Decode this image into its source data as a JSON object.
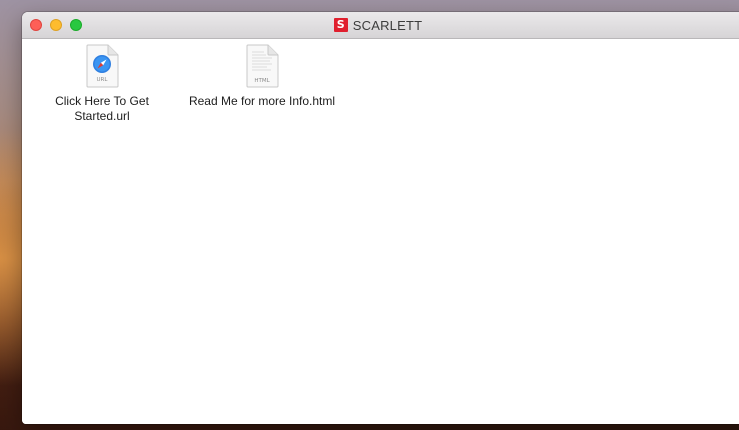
{
  "window": {
    "title": "SCARLETT",
    "logo_letter": "S",
    "logo_color": "#e01f2e"
  },
  "traffic_lights": {
    "close_color": "#fe5f57",
    "minimize_color": "#febc2e",
    "maximize_color": "#28c840"
  },
  "files": [
    {
      "name": "Click Here To Get Started.url",
      "label_line1": "Click Here To Get",
      "label_line2": "Started.url",
      "badge": "URL",
      "icon": "safari-compass-icon"
    },
    {
      "name": "Read Me for more Info.html",
      "label_line1": "Read Me for more Info.html",
      "badge": "HTML",
      "icon": "html-document-icon"
    }
  ]
}
